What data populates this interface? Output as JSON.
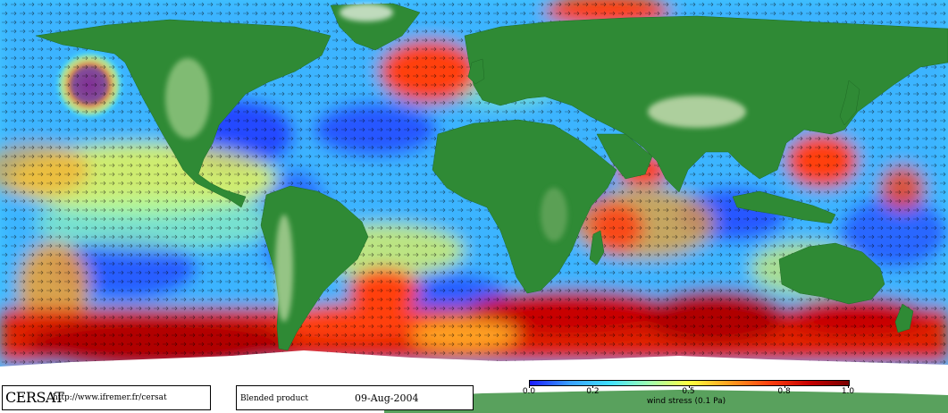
{
  "map": {
    "product_credit": "CERSAT",
    "product_url": "http://www.ifremer.fr/cersat",
    "product_label": "Blended product",
    "date": "09-Aug-2004"
  },
  "legend": {
    "title": "wind stress (0.1 Pa)",
    "ticks": [
      "0.0",
      "0.2",
      "0.5",
      "0.8",
      "1.0"
    ],
    "tick_values": [
      0.0,
      0.2,
      0.5,
      0.8,
      1.0
    ],
    "range": [
      0.0,
      1.0
    ],
    "colormap": [
      "#1a1aff",
      "#3aa0ff",
      "#40e0ff",
      "#a0ffb0",
      "#ffff40",
      "#ffa020",
      "#ff4010",
      "#c80000",
      "#7a0000"
    ]
  },
  "colors": {
    "land_low": "#2f8a35",
    "land_high": "#d8e6c0",
    "ice": "#ffffff",
    "arrow": "#000000"
  }
}
